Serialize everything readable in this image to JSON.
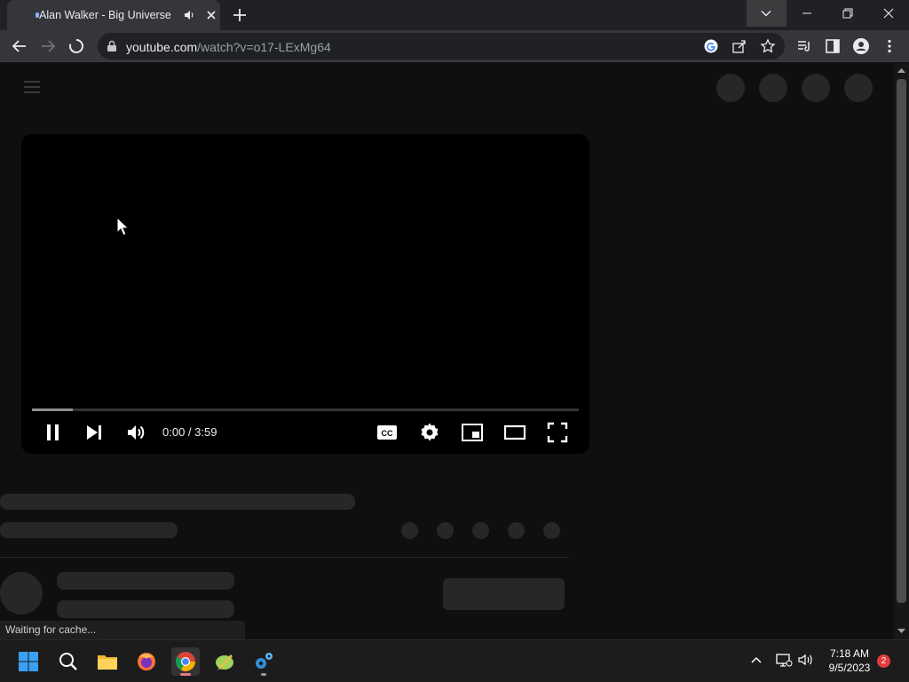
{
  "browser": {
    "tab": {
      "title": "Alan Walker - Big Universe -",
      "audio_icon": "speaker-icon",
      "close_icon": "close-icon"
    },
    "new_tab_icon": "plus-icon",
    "tab_search_icon": "chevron-down-icon",
    "window_controls": [
      "minimize-icon",
      "restore-icon",
      "close-icon"
    ],
    "nav": {
      "back_icon": "arrow-left-icon",
      "forward_icon": "arrow-right-icon",
      "stop_icon": "loading-spinner-icon"
    },
    "address": {
      "host": "youtube.com",
      "path": "/watch?v=o17-LExMg64"
    },
    "omnibox_icons": [
      "google-lens-icon",
      "share-icon",
      "star-icon"
    ],
    "toolbar_icons": [
      "media-queue-icon",
      "side-panel-icon",
      "profile-icon",
      "more-menu-icon"
    ],
    "status": "Waiting for cache..."
  },
  "player": {
    "time": "0:00 / 3:59",
    "progress_loaded": 0.075,
    "controls": [
      "pause-icon",
      "next-icon",
      "volume-icon",
      "captions-icon",
      "settings-icon",
      "miniplayer-icon",
      "theater-mode-icon",
      "fullscreen-icon"
    ]
  },
  "taskbar": {
    "apps": [
      "start-icon",
      "search-icon",
      "file-explorer-icon",
      "firefox-icon",
      "chrome-icon",
      "notepad-plus-plus-icon",
      "settings-gears-icon"
    ],
    "tray": [
      "chevron-up-icon",
      "network-icon",
      "volume-icon"
    ],
    "time": "7:18 AM",
    "date": "9/5/2023",
    "notifications": "2"
  },
  "colors": {
    "page_bg": "#0f0f0f",
    "skeleton": "#272727",
    "tab_active": "#35363a",
    "tab_strip": "#202124"
  }
}
